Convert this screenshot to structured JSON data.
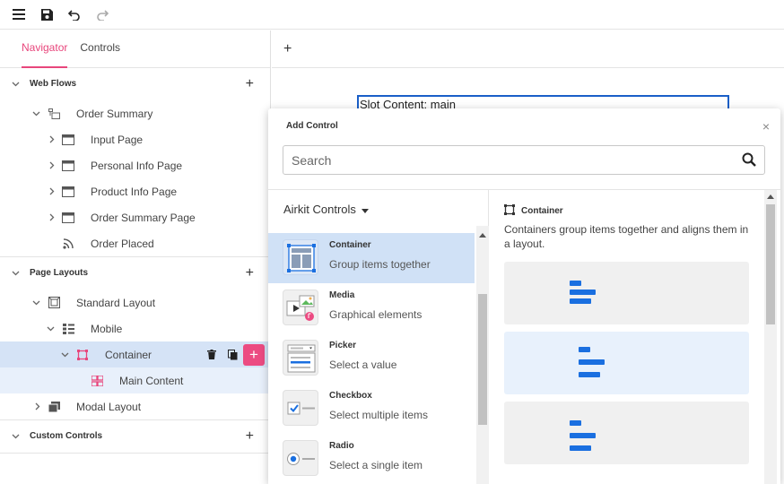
{
  "toolbar": {
    "icons": [
      "hamburger-icon",
      "save-icon",
      "undo-icon",
      "redo-icon"
    ]
  },
  "left_panel": {
    "tabs": [
      {
        "label": "Navigator",
        "active": true
      },
      {
        "label": "Controls",
        "active": false
      }
    ],
    "sections": {
      "web_flows": "Web Flows",
      "page_layouts": "Page Layouts",
      "custom_controls": "Custom Controls"
    },
    "items": {
      "order_summary": "Order Summary",
      "input_page": "Input Page",
      "personal_info_page": "Personal Info Page",
      "product_info_page": "Product Info Page",
      "order_summary_page": "Order Summary Page",
      "order_placed": "Order Placed",
      "standard_layout": "Standard Layout",
      "mobile": "Mobile",
      "container": "Container",
      "main_content": "Main Content",
      "modal_layout": "Modal Layout"
    }
  },
  "canvas": {
    "add_label": "+",
    "slot_label": "Slot Content: main"
  },
  "popup": {
    "title": "Add Control",
    "close": "×",
    "search_placeholder": "Search",
    "library": "Airkit Controls",
    "controls": [
      {
        "name": "Container",
        "desc": "Group items together",
        "selected": true
      },
      {
        "name": "Media",
        "desc": "Graphical elements",
        "selected": false
      },
      {
        "name": "Picker",
        "desc": "Select a value",
        "selected": false
      },
      {
        "name": "Checkbox",
        "desc": "Select multiple items",
        "selected": false
      },
      {
        "name": "Radio",
        "desc": "Select a single item",
        "selected": false
      }
    ],
    "detail": {
      "title": "Container",
      "description": "Containers group items together and aligns them in a layout."
    }
  },
  "colors": {
    "accent_pink": "#e8467c",
    "selection_blue": "#d5e3f6",
    "primary_blue": "#1a6fe0"
  }
}
